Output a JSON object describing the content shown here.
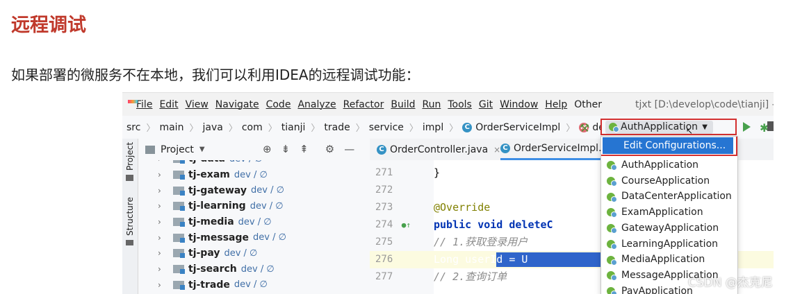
{
  "heading": "远程调试",
  "paragraph": "如果部署的微服务不在本地，我们可以利用IDEA的远程调试功能：",
  "ide": {
    "menu": [
      "File",
      "Edit",
      "View",
      "Navigate",
      "Code",
      "Analyze",
      "Refactor",
      "Build",
      "Run",
      "Tools",
      "Git",
      "Window",
      "Help",
      "Other"
    ],
    "window_title": "tjxt [D:\\develop\\code\\tianji] - OrderSe",
    "breadcrumb": [
      "src",
      "main",
      "java",
      "com",
      "tianji",
      "trade",
      "service",
      "impl",
      "OrderServiceImpl",
      "deleteOrder"
    ],
    "breadcrumb_class_icon": "C",
    "breadcrumb_method_icon": "m",
    "run_config": {
      "selected": "AuthApplication",
      "edit_label": "Edit Configurations...",
      "options": [
        "AuthApplication",
        "CourseApplication",
        "DataCenterApplication",
        "ExamApplication",
        "GatewayApplication",
        "LearningApplication",
        "MediaApplication",
        "MessageApplication",
        "PayApplication"
      ]
    },
    "side_tabs": {
      "project": "Project",
      "structure": "Structure"
    },
    "project_panel": {
      "title": "Project",
      "modules": [
        {
          "name": "tj-data",
          "branch": "dev / ∅"
        },
        {
          "name": "tj-exam",
          "branch": "dev / ∅"
        },
        {
          "name": "tj-gateway",
          "branch": "dev / ∅"
        },
        {
          "name": "tj-learning",
          "branch": "dev / ∅"
        },
        {
          "name": "tj-media",
          "branch": "dev / ∅"
        },
        {
          "name": "tj-message",
          "branch": "dev / ∅"
        },
        {
          "name": "tj-pay",
          "branch": "dev / ∅"
        },
        {
          "name": "tj-search",
          "branch": "dev / ∅"
        },
        {
          "name": "tj-trade",
          "branch": "dev / ∅"
        }
      ]
    },
    "tabs": [
      {
        "label": "OrderController.java",
        "close": "×"
      },
      {
        "label": "OrderServiceImpl.java",
        "close": ""
      }
    ],
    "editor": {
      "line_numbers": [
        "271",
        "272",
        "273",
        "274",
        "275",
        "276",
        "277"
      ],
      "lines": [
        "    }",
        "",
        "    @Override",
        "    public void deleteC",
        "        // 1.获取登录用户",
        "        Long userId = U",
        "        // 2.查询订单"
      ],
      "selection_tail": ");"
    },
    "icons": {
      "hammer": "hammer-icon",
      "run": "run-icon",
      "debug": "debug-icon",
      "spring": "spring-boot-icon",
      "bulb": "lightbulb-icon"
    },
    "colors": {
      "accent": "#2675d2",
      "highlight_box": "#d32f2f",
      "heading": "#c0392b"
    }
  },
  "watermark": "CSDN @杰克尼"
}
